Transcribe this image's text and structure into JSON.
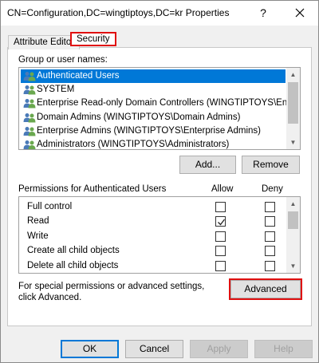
{
  "window": {
    "title": "CN=Configuration,DC=wingtiptoys,DC=kr Properties",
    "help": "?",
    "close": "✕"
  },
  "tabs": [
    "Attribute Editor",
    "Security"
  ],
  "groups": {
    "label": "Group or user names:",
    "items": [
      "Authenticated Users",
      "SYSTEM",
      "Enterprise Read-only Domain Controllers (WINGTIPTOYS\\Ent...",
      "Domain Admins (WINGTIPTOYS\\Domain Admins)",
      "Enterprise Admins (WINGTIPTOYS\\Enterprise Admins)",
      "Administrators (WINGTIPTOYS\\Administrators)"
    ],
    "selected": 0
  },
  "buttons": {
    "add": "Add...",
    "remove": "Remove",
    "advanced": "Advanced",
    "ok": "OK",
    "cancel": "Cancel",
    "apply": "Apply",
    "help": "Help"
  },
  "permissions": {
    "label": "Permissions for Authenticated Users",
    "allow": "Allow",
    "deny": "Deny",
    "rows": [
      {
        "name": "Full control",
        "allow": false,
        "deny": false
      },
      {
        "name": "Read",
        "allow": true,
        "deny": false
      },
      {
        "name": "Write",
        "allow": false,
        "deny": false
      },
      {
        "name": "Create all child objects",
        "allow": false,
        "deny": false
      },
      {
        "name": "Delete all child objects",
        "allow": false,
        "deny": false
      }
    ]
  },
  "special": {
    "text": "For special permissions or advanced settings, click Advanced."
  },
  "colors": {
    "selection": "#0078d7",
    "highlight_frame": "#e01010"
  }
}
